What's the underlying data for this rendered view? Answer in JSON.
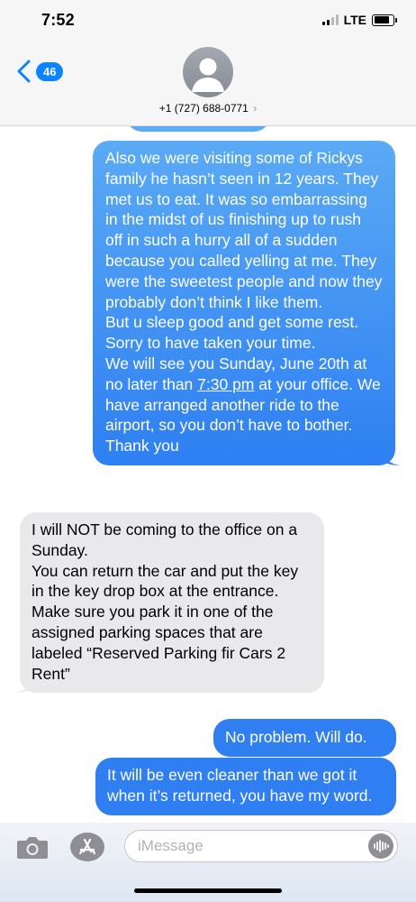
{
  "status_bar": {
    "time": "7:52",
    "network": "LTE",
    "signal_bars_filled": 2,
    "signal_bars_total": 4,
    "battery_level": 0.8
  },
  "header": {
    "back_count": "46",
    "contact": "+1 (727) 688-0771",
    "chevron": "›"
  },
  "messages": [
    {
      "direction": "outgoing",
      "parts": [
        "Also we were visiting some of Rickys family he hasn’t seen in 12 years. They met us to eat. It was so embarrassing in the midst of us finishing up to rush off in such a hurry all of a sudden because you called yelling at me. They were the sweetest people and now they probably don’t think I like them.\nBut u sleep good and get some rest. Sorry to have taken your time.\nWe will see you Sunday, June 20th at no later than ",
        "7:30 pm",
        " at your office. We have arranged another ride to the airport, so you don’t have to bother.\nThank you"
      ]
    },
    {
      "direction": "incoming",
      "text": "I will NOT be coming to the office on a Sunday.\nYou can return the car and put the key in the key drop box at the entrance.\nMake sure you park it in one of the assigned parking spaces that are labeled “Reserved Parking fir Cars 2 Rent”"
    },
    {
      "direction": "outgoing",
      "text": "No problem. Will do."
    },
    {
      "direction": "outgoing",
      "text": "It will be even cleaner than we got it when it’s returned, you have my word."
    }
  ],
  "input": {
    "placeholder": "iMessage"
  },
  "colors": {
    "outgoing_top": "#5aaaf5",
    "outgoing_bottom": "#2e7ff2",
    "incoming": "#e9e9eb",
    "accent": "#0a84ff"
  },
  "icons": {
    "back": "chevron-left-icon",
    "avatar": "person-silhouette-icon",
    "camera": "camera-icon",
    "apps": "app-store-icon",
    "audio": "audio-waveform-icon"
  }
}
